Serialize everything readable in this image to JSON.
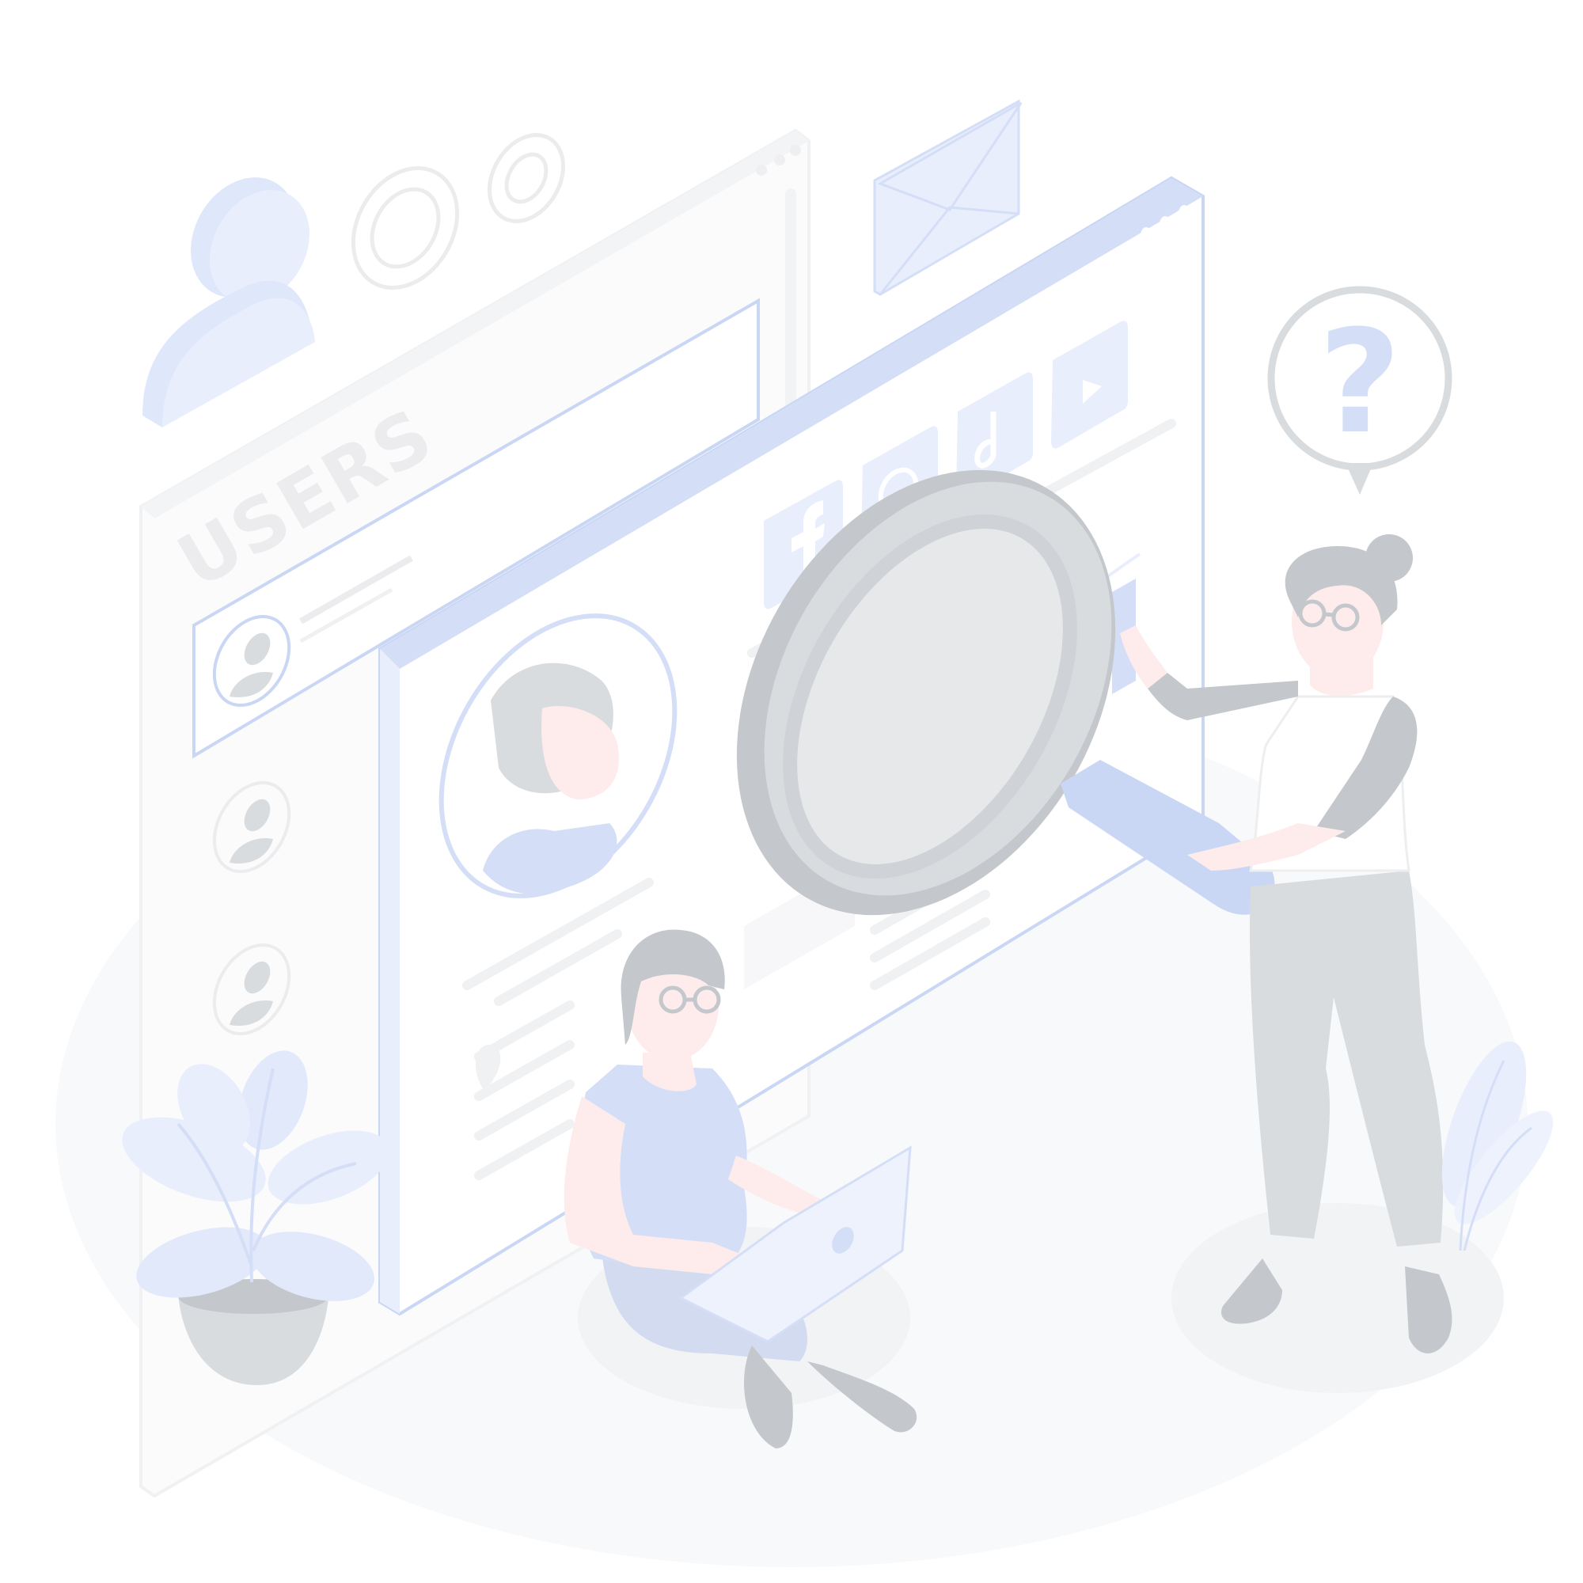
{
  "scene": {
    "users_panel": {
      "heading": "USERS"
    },
    "question_bubble": {
      "symbol": "?"
    },
    "social_icons": [
      "facebook-icon",
      "instagram-icon",
      "tiktok-icon",
      "youtube-icon"
    ],
    "colors": {
      "accent_blue": "#d4def7",
      "light_blue": "#e8eefc",
      "outline_blue": "#c9d7f5",
      "gray": "#d9dcdf",
      "dark_gray": "#c4c7cb",
      "skin": "#fdeceb",
      "floor": "#f7f8fb",
      "panel_faint": "#f4f5f7"
    }
  }
}
